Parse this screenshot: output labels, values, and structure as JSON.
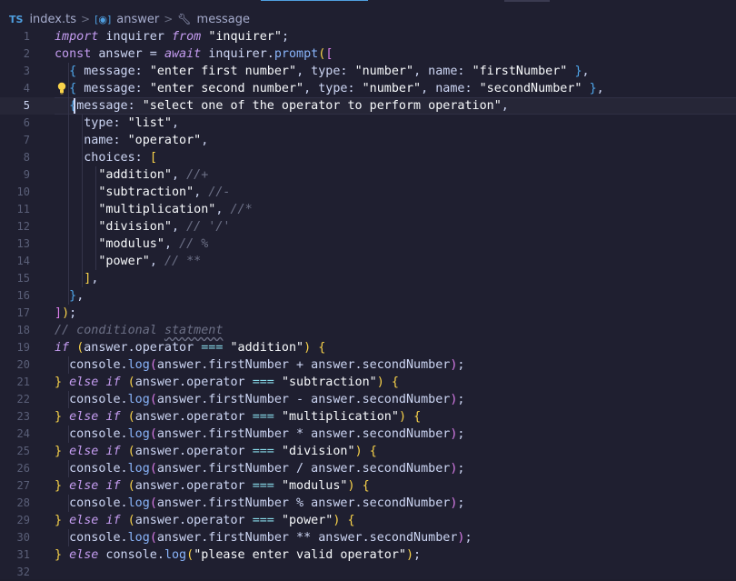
{
  "breadcrumb": {
    "file_badge": "TS",
    "file": "index.ts",
    "symbol1": "answer",
    "symbol2": "message",
    "separator": ">"
  },
  "editor": {
    "active_line": 5,
    "lines": [
      {
        "n": "1",
        "tokens": [
          [
            "kw",
            "import"
          ],
          [
            "t",
            " inquirer "
          ],
          [
            "kw",
            "from"
          ],
          [
            "t",
            " "
          ],
          [
            "str",
            "\"inquirer\""
          ],
          [
            "t",
            ";"
          ]
        ]
      },
      {
        "n": "2",
        "tokens": [
          [
            "kwc",
            "const"
          ],
          [
            "t",
            " answer = "
          ],
          [
            "kw",
            "await"
          ],
          [
            "t",
            " inquirer."
          ],
          [
            "fn",
            "prompt"
          ],
          [
            "br1",
            "("
          ],
          [
            "br2",
            "["
          ]
        ]
      },
      {
        "n": "3",
        "tokens": [
          [
            "t",
            "  "
          ],
          [
            "br3",
            "{"
          ],
          [
            "t",
            " message: "
          ],
          [
            "str",
            "\"enter first number\""
          ],
          [
            "t",
            ", type: "
          ],
          [
            "str",
            "\"number\""
          ],
          [
            "t",
            ", name: "
          ],
          [
            "str",
            "\"firstNumber\""
          ],
          [
            "t",
            " "
          ],
          [
            "br3",
            "}"
          ],
          [
            "t",
            ","
          ]
        ]
      },
      {
        "n": "4",
        "tokens": [
          [
            "t",
            "  "
          ],
          [
            "br3",
            "{"
          ],
          [
            "t",
            " message: "
          ],
          [
            "str",
            "\"enter second number\""
          ],
          [
            "t",
            ", type: "
          ],
          [
            "str",
            "\"number\""
          ],
          [
            "t",
            ", name: "
          ],
          [
            "str",
            "\"secondNumber\""
          ],
          [
            "t",
            " "
          ],
          [
            "br3",
            "}"
          ],
          [
            "t",
            ","
          ]
        ]
      },
      {
        "n": "5",
        "tokens": [
          [
            "t",
            "  "
          ],
          [
            "br3",
            "{"
          ],
          [
            "t",
            "message: "
          ],
          [
            "str",
            "\"select one of the operator to perform operation\""
          ],
          [
            "t",
            ","
          ]
        ]
      },
      {
        "n": "6",
        "tokens": [
          [
            "t",
            "    type: "
          ],
          [
            "str",
            "\"list\""
          ],
          [
            "t",
            ","
          ]
        ]
      },
      {
        "n": "7",
        "tokens": [
          [
            "t",
            "    name: "
          ],
          [
            "str",
            "\"operator\""
          ],
          [
            "t",
            ","
          ]
        ]
      },
      {
        "n": "8",
        "tokens": [
          [
            "t",
            "    choices: "
          ],
          [
            "br1",
            "["
          ]
        ]
      },
      {
        "n": "9",
        "tokens": [
          [
            "t",
            "      "
          ],
          [
            "str",
            "\"addition\""
          ],
          [
            "t",
            ", "
          ],
          [
            "cm",
            "//+"
          ]
        ]
      },
      {
        "n": "10",
        "tokens": [
          [
            "t",
            "      "
          ],
          [
            "str",
            "\"subtraction\""
          ],
          [
            "t",
            ", "
          ],
          [
            "cm",
            "//-"
          ]
        ]
      },
      {
        "n": "11",
        "tokens": [
          [
            "t",
            "      "
          ],
          [
            "str",
            "\"multiplication\""
          ],
          [
            "t",
            ", "
          ],
          [
            "cm",
            "//*"
          ]
        ]
      },
      {
        "n": "12",
        "tokens": [
          [
            "t",
            "      "
          ],
          [
            "str",
            "\"division\""
          ],
          [
            "t",
            ", "
          ],
          [
            "cm",
            "// '/'"
          ]
        ]
      },
      {
        "n": "13",
        "tokens": [
          [
            "t",
            "      "
          ],
          [
            "str",
            "\"modulus\""
          ],
          [
            "t",
            ", "
          ],
          [
            "cm",
            "// %"
          ]
        ]
      },
      {
        "n": "14",
        "tokens": [
          [
            "t",
            "      "
          ],
          [
            "str",
            "\"power\""
          ],
          [
            "t",
            ", "
          ],
          [
            "cm",
            "// **"
          ]
        ]
      },
      {
        "n": "15",
        "tokens": [
          [
            "t",
            "    "
          ],
          [
            "br1",
            "]"
          ],
          [
            "t",
            ","
          ]
        ]
      },
      {
        "n": "16",
        "tokens": [
          [
            "t",
            "  "
          ],
          [
            "br3",
            "}"
          ],
          [
            "t",
            ","
          ]
        ]
      },
      {
        "n": "17",
        "tokens": [
          [
            "br2",
            "]"
          ],
          [
            "br1",
            ")"
          ],
          [
            "t",
            ";"
          ]
        ]
      },
      {
        "n": "18",
        "tokens": [
          [
            "cm",
            "// conditional "
          ],
          [
            "cmsq",
            "statment"
          ]
        ]
      },
      {
        "n": "19",
        "tokens": [
          [
            "kw",
            "if"
          ],
          [
            "t",
            " "
          ],
          [
            "br1",
            "("
          ],
          [
            "t",
            "answer.operator "
          ],
          [
            "op",
            "==="
          ],
          [
            "t",
            " "
          ],
          [
            "str",
            "\"addition\""
          ],
          [
            "br1",
            ")"
          ],
          [
            "t",
            " "
          ],
          [
            "br1",
            "{"
          ]
        ]
      },
      {
        "n": "20",
        "tokens": [
          [
            "t",
            "  console."
          ],
          [
            "fn",
            "log"
          ],
          [
            "br2",
            "("
          ],
          [
            "t",
            "answer.firstNumber + answer.secondNumber"
          ],
          [
            "br2",
            ")"
          ],
          [
            "t",
            ";"
          ]
        ]
      },
      {
        "n": "21",
        "tokens": [
          [
            "br1",
            "}"
          ],
          [
            "t",
            " "
          ],
          [
            "kw",
            "else"
          ],
          [
            "t",
            " "
          ],
          [
            "kw",
            "if"
          ],
          [
            "t",
            " "
          ],
          [
            "br1",
            "("
          ],
          [
            "t",
            "answer.operator "
          ],
          [
            "op",
            "==="
          ],
          [
            "t",
            " "
          ],
          [
            "str",
            "\"subtraction\""
          ],
          [
            "br1",
            ")"
          ],
          [
            "t",
            " "
          ],
          [
            "br1",
            "{"
          ]
        ]
      },
      {
        "n": "22",
        "tokens": [
          [
            "t",
            "  console."
          ],
          [
            "fn",
            "log"
          ],
          [
            "br2",
            "("
          ],
          [
            "t",
            "answer.firstNumber - answer.secondNumber"
          ],
          [
            "br2",
            ")"
          ],
          [
            "t",
            ";"
          ]
        ]
      },
      {
        "n": "23",
        "tokens": [
          [
            "br1",
            "}"
          ],
          [
            "t",
            " "
          ],
          [
            "kw",
            "else"
          ],
          [
            "t",
            " "
          ],
          [
            "kw",
            "if"
          ],
          [
            "t",
            " "
          ],
          [
            "br1",
            "("
          ],
          [
            "t",
            "answer.operator "
          ],
          [
            "op",
            "==="
          ],
          [
            "t",
            " "
          ],
          [
            "str",
            "\"multiplication\""
          ],
          [
            "br1",
            ")"
          ],
          [
            "t",
            " "
          ],
          [
            "br1",
            "{"
          ]
        ]
      },
      {
        "n": "24",
        "tokens": [
          [
            "t",
            "  console."
          ],
          [
            "fn",
            "log"
          ],
          [
            "br2",
            "("
          ],
          [
            "t",
            "answer.firstNumber * answer.secondNumber"
          ],
          [
            "br2",
            ")"
          ],
          [
            "t",
            ";"
          ]
        ]
      },
      {
        "n": "25",
        "tokens": [
          [
            "br1",
            "}"
          ],
          [
            "t",
            " "
          ],
          [
            "kw",
            "else"
          ],
          [
            "t",
            " "
          ],
          [
            "kw",
            "if"
          ],
          [
            "t",
            " "
          ],
          [
            "br1",
            "("
          ],
          [
            "t",
            "answer.operator "
          ],
          [
            "op",
            "==="
          ],
          [
            "t",
            " "
          ],
          [
            "str",
            "\"division\""
          ],
          [
            "br1",
            ")"
          ],
          [
            "t",
            " "
          ],
          [
            "br1",
            "{"
          ]
        ]
      },
      {
        "n": "26",
        "tokens": [
          [
            "t",
            "  console."
          ],
          [
            "fn",
            "log"
          ],
          [
            "br2",
            "("
          ],
          [
            "t",
            "answer.firstNumber / answer.secondNumber"
          ],
          [
            "br2",
            ")"
          ],
          [
            "t",
            ";"
          ]
        ]
      },
      {
        "n": "27",
        "tokens": [
          [
            "br1",
            "}"
          ],
          [
            "t",
            " "
          ],
          [
            "kw",
            "else"
          ],
          [
            "t",
            " "
          ],
          [
            "kw",
            "if"
          ],
          [
            "t",
            " "
          ],
          [
            "br1",
            "("
          ],
          [
            "t",
            "answer.operator "
          ],
          [
            "op",
            "==="
          ],
          [
            "t",
            " "
          ],
          [
            "str",
            "\"modulus\""
          ],
          [
            "br1",
            ")"
          ],
          [
            "t",
            " "
          ],
          [
            "br1",
            "{"
          ]
        ]
      },
      {
        "n": "28",
        "tokens": [
          [
            "t",
            "  console."
          ],
          [
            "fn",
            "log"
          ],
          [
            "br2",
            "("
          ],
          [
            "t",
            "answer.firstNumber % answer.secondNumber"
          ],
          [
            "br2",
            ")"
          ],
          [
            "t",
            ";"
          ]
        ]
      },
      {
        "n": "29",
        "tokens": [
          [
            "br1",
            "}"
          ],
          [
            "t",
            " "
          ],
          [
            "kw",
            "else"
          ],
          [
            "t",
            " "
          ],
          [
            "kw",
            "if"
          ],
          [
            "t",
            " "
          ],
          [
            "br1",
            "("
          ],
          [
            "t",
            "answer.operator "
          ],
          [
            "op",
            "==="
          ],
          [
            "t",
            " "
          ],
          [
            "str",
            "\"power\""
          ],
          [
            "br1",
            ")"
          ],
          [
            "t",
            " "
          ],
          [
            "br1",
            "{"
          ]
        ]
      },
      {
        "n": "30",
        "tokens": [
          [
            "t",
            "  console."
          ],
          [
            "fn",
            "log"
          ],
          [
            "br2",
            "("
          ],
          [
            "t",
            "answer.firstNumber ** answer.secondNumber"
          ],
          [
            "br2",
            ")"
          ],
          [
            "t",
            ";"
          ]
        ]
      },
      {
        "n": "31",
        "tokens": [
          [
            "br1",
            "}"
          ],
          [
            "t",
            " "
          ],
          [
            "kw",
            "else"
          ],
          [
            "t",
            " console."
          ],
          [
            "fn",
            "log"
          ],
          [
            "br1",
            "("
          ],
          [
            "str",
            "\"please enter valid operator\""
          ],
          [
            "br1",
            ")"
          ],
          [
            "t",
            ";"
          ]
        ]
      },
      {
        "n": "32",
        "tokens": []
      }
    ]
  },
  "icons": {
    "lightbulb": "lightbulb-icon",
    "symbol_variable": "variable-symbol-icon",
    "symbol_property": "property-wrench-icon"
  },
  "colors": {
    "background": "#1f1f30",
    "keyword": "#c49cf0",
    "function": "#89b4fa",
    "comment": "#6c7086",
    "bracket_gold": "#f9d34a",
    "bracket_pink": "#d87ce8",
    "bracket_blue": "#4fa6ea",
    "lightbulb": "#f9d34a"
  }
}
